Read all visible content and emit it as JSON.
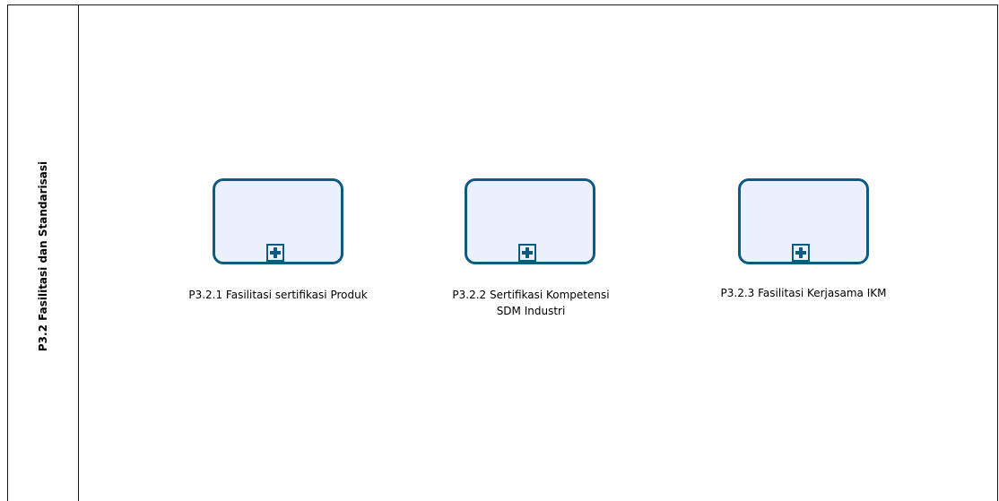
{
  "colors": {
    "task_border": "#10597f",
    "task_fill": "#ecf0fc",
    "lane_border": "#1a1a1a"
  },
  "lane": {
    "title": "P3.2 Fasilitasi dan Standarisasi"
  },
  "tasks": [
    {
      "label_lines": [
        "P3.2.1 Fasilitasi sertifikasi Produk"
      ],
      "marker_icon": "plus-icon"
    },
    {
      "label_lines": [
        "P3.2.2 Sertifikasi Kompetensi",
        "SDM Industri"
      ],
      "marker_icon": "plus-icon"
    },
    {
      "label_lines": [
        "P3.2.3 Fasilitasi Kerjasama IKM"
      ],
      "marker_icon": "plus-icon"
    }
  ]
}
